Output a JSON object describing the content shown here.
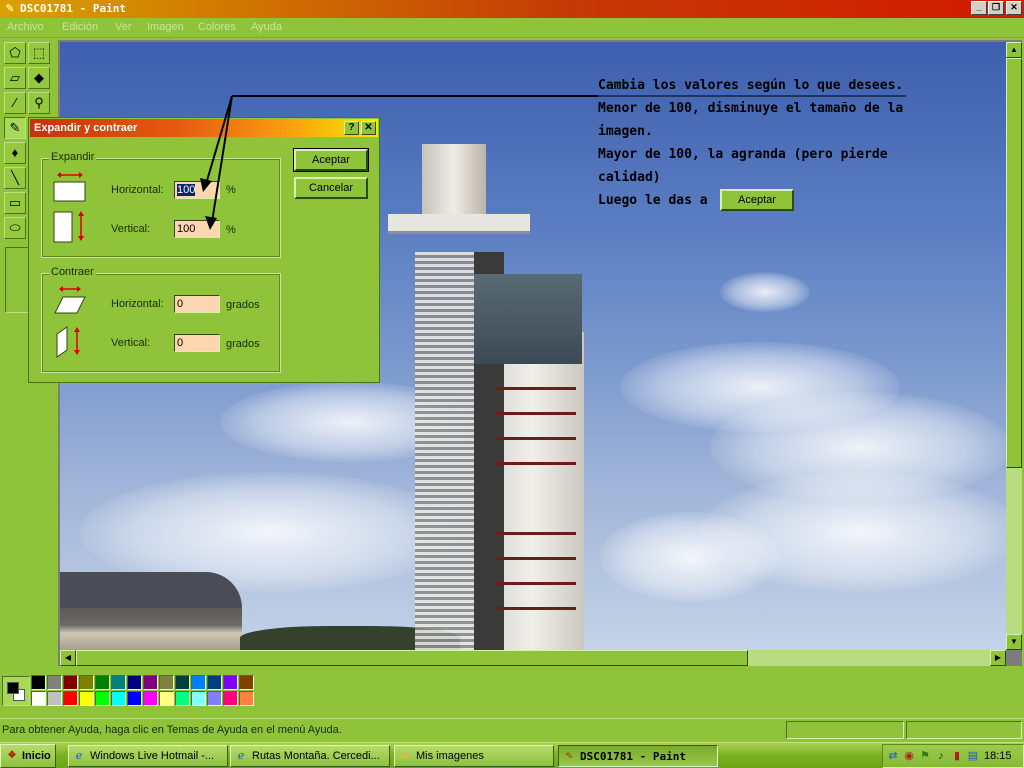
{
  "window": {
    "title": "DSC01781 - Paint",
    "app_icon": "paint-brush-icon",
    "buttons": {
      "minimize": "_",
      "restore": "❐",
      "close": "✕"
    }
  },
  "menu": [
    "Archivo",
    "Edición",
    "Ver",
    "Imagen",
    "Colores",
    "Ayuda"
  ],
  "tools": [
    "free-select-icon",
    "rect-select-icon",
    "eraser-icon",
    "fill-bucket-icon",
    "color-picker-icon",
    "magnifier-icon",
    "pencil-icon",
    "brush-icon",
    "airbrush-icon",
    "text-icon",
    "line-icon",
    "curve-icon",
    "rectangle-icon",
    "polygon-icon",
    "ellipse-icon",
    "rounded-rect-icon"
  ],
  "annotation": {
    "lines": [
      "Cambia los valores según lo que desees.",
      "Menor de 100, disminuye el tamaño de la",
      "imagen.",
      "Mayor de 100, la agranda (pero pierde",
      "calidad)",
      "Luego le das a"
    ],
    "button_label": "Aceptar"
  },
  "dialog": {
    "title": "Expandir y contraer",
    "help_btn": "?",
    "close_btn": "✕",
    "expand": {
      "label": "Expandir",
      "horizontal_label": "Horizontal:",
      "horizontal_value": "100",
      "horizontal_unit": "%",
      "vertical_label": "Vertical:",
      "vertical_value": "100",
      "vertical_unit": "%"
    },
    "contract": {
      "label": "Contraer",
      "horizontal_label": "Horizontal:",
      "horizontal_value": "0",
      "horizontal_unit": "grados",
      "vertical_label": "Vertical:",
      "vertical_value": "0",
      "vertical_unit": "grados"
    },
    "ok_label": "Aceptar",
    "cancel_label": "Cancelar"
  },
  "palette": {
    "foreground": "#000000",
    "background": "#ffffff",
    "colors": [
      "#000000",
      "#808080",
      "#800000",
      "#808000",
      "#008000",
      "#008080",
      "#000080",
      "#800080",
      "#808040",
      "#004040",
      "#0080ff",
      "#004080",
      "#8000ff",
      "#804000",
      "#ffffff",
      "#c0c0c0",
      "#ff0000",
      "#ffff00",
      "#00ff00",
      "#00ffff",
      "#0000ff",
      "#ff00ff",
      "#ffff80",
      "#00ff80",
      "#80ffff",
      "#8080ff",
      "#ff0080",
      "#ff8040"
    ]
  },
  "statusbar": {
    "message": "Para obtener Ayuda, haga clic en Temas de Ayuda en el menú Ayuda."
  },
  "taskbar": {
    "start_label": "Inicio",
    "tasks": [
      {
        "label": "Windows Live Hotmail -...",
        "icon": "ie-icon",
        "active": false
      },
      {
        "label": "Rutas Montaña. Cercedi...",
        "icon": "ie-icon",
        "active": false
      },
      {
        "label": "Mis imagenes",
        "icon": "folder-icon",
        "active": false
      },
      {
        "label": "DSC01781 - Paint",
        "icon": "paint-icon",
        "active": true
      }
    ],
    "clock": "18:15"
  }
}
